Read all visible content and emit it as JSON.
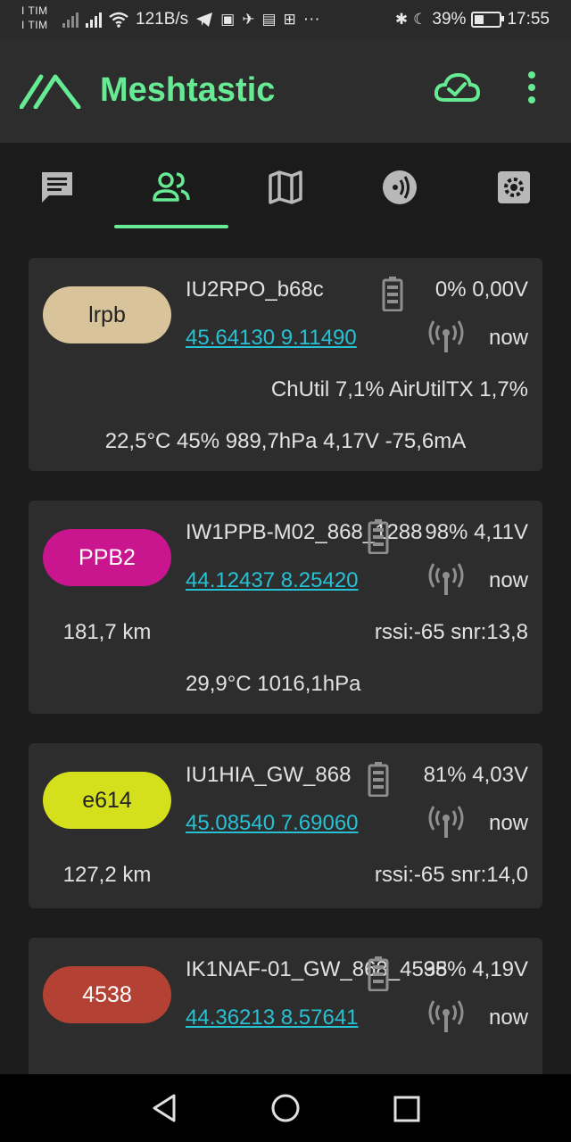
{
  "status_bar": {
    "carrier_1": "I TIM",
    "carrier_2": "I TIM",
    "net_speed": "121B/s",
    "more": "···",
    "battery": "39%",
    "battery_level": 0.39,
    "time": "17:55"
  },
  "app_bar": {
    "title": "Meshtastic",
    "accent_color": "#67ea94"
  },
  "tabs": [
    {
      "icon": "chat-icon"
    },
    {
      "icon": "people-icon",
      "selected": true
    },
    {
      "icon": "map-icon"
    },
    {
      "icon": "radio-icon"
    },
    {
      "icon": "settings-icon"
    }
  ],
  "nodes": [
    {
      "chip": "lrpb",
      "chip_color": "#d8c39a",
      "chip_text_color": "#222222",
      "name": "IU2RPO_b68c",
      "battery": "0% 0,00V",
      "coords": "45.64130 9.11490",
      "last_heard": "now",
      "util": "ChUtil 7,1% AirUtilTX 1,7%",
      "env": "22,5°C 45% 989,7hPa 4,17V -75,6mA"
    },
    {
      "chip": "PPB2",
      "chip_color": "#c9158e",
      "chip_text_color": "#ffffff",
      "name": "IW1PPB-M02_868_1288",
      "battery": "98% 4,11V",
      "coords": "44.12437 8.25420",
      "last_heard": "now",
      "distance": "181,7 km",
      "signal": "rssi:-65 snr:13,8",
      "env": "29,9°C 1016,1hPa"
    },
    {
      "chip": "e614",
      "chip_color": "#d5e01c",
      "chip_text_color": "#222222",
      "name": "IU1HIA_GW_868",
      "battery": "81% 4,03V",
      "coords": "45.08540 7.69060",
      "last_heard": "now",
      "distance": "127,2 km",
      "signal": "rssi:-65 snr:14,0"
    },
    {
      "chip": "4538",
      "chip_color": "#b44234",
      "chip_text_color": "#ffffff",
      "name": "IK1NAF-01_GW_868_4538",
      "battery": "95% 4,19V",
      "coords": "44.36213 8.57641",
      "last_heard": "now"
    }
  ]
}
